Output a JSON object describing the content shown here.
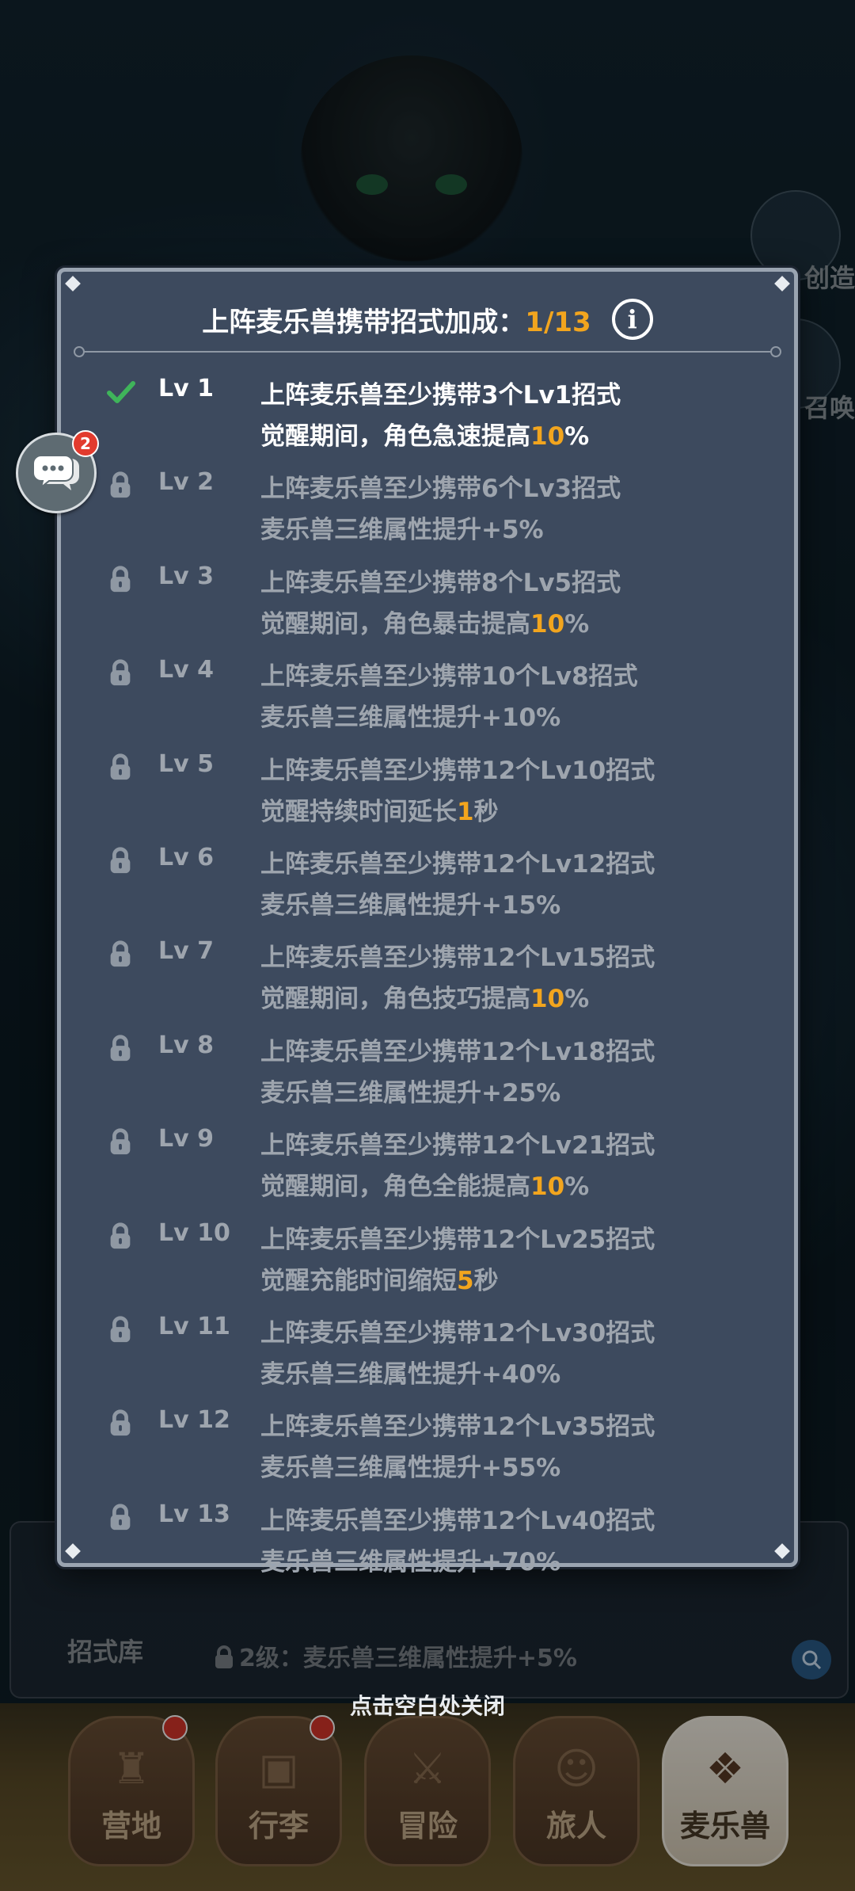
{
  "modal": {
    "title": "上阵麦乐兽携带招式加成：",
    "progress": "1/13",
    "info_symbol": "i",
    "levels": [
      {
        "lv": "Lv 1",
        "unlocked": true,
        "requirement": "上阵麦乐兽至少携带3个Lv1招式",
        "effect_prefix": "觉醒期间，角色急速提高",
        "effect_highlight": "10",
        "effect_suffix": "%"
      },
      {
        "lv": "Lv 2",
        "unlocked": false,
        "requirement": "上阵麦乐兽至少携带6个Lv3招式",
        "effect_prefix": "麦乐兽三维属性提升+5%",
        "effect_highlight": "",
        "effect_suffix": ""
      },
      {
        "lv": "Lv 3",
        "unlocked": false,
        "requirement": "上阵麦乐兽至少携带8个Lv5招式",
        "effect_prefix": "觉醒期间，角色暴击提高",
        "effect_highlight": "10",
        "effect_suffix": "%"
      },
      {
        "lv": "Lv 4",
        "unlocked": false,
        "requirement": "上阵麦乐兽至少携带10个Lv8招式",
        "effect_prefix": "麦乐兽三维属性提升+10%",
        "effect_highlight": "",
        "effect_suffix": ""
      },
      {
        "lv": "Lv 5",
        "unlocked": false,
        "requirement": "上阵麦乐兽至少携带12个Lv10招式",
        "effect_prefix": "觉醒持续时间延长",
        "effect_highlight": "1",
        "effect_suffix": "秒"
      },
      {
        "lv": "Lv 6",
        "unlocked": false,
        "requirement": "上阵麦乐兽至少携带12个Lv12招式",
        "effect_prefix": "麦乐兽三维属性提升+15%",
        "effect_highlight": "",
        "effect_suffix": ""
      },
      {
        "lv": "Lv 7",
        "unlocked": false,
        "requirement": "上阵麦乐兽至少携带12个Lv15招式",
        "effect_prefix": "觉醒期间，角色技巧提高",
        "effect_highlight": "10",
        "effect_suffix": "%"
      },
      {
        "lv": "Lv 8",
        "unlocked": false,
        "requirement": "上阵麦乐兽至少携带12个Lv18招式",
        "effect_prefix": "麦乐兽三维属性提升+25%",
        "effect_highlight": "",
        "effect_suffix": ""
      },
      {
        "lv": "Lv 9",
        "unlocked": false,
        "requirement": "上阵麦乐兽至少携带12个Lv21招式",
        "effect_prefix": "觉醒期间，角色全能提高",
        "effect_highlight": "10",
        "effect_suffix": "%"
      },
      {
        "lv": "Lv 10",
        "unlocked": false,
        "requirement": "上阵麦乐兽至少携带12个Lv25招式",
        "effect_prefix": "觉醒充能时间缩短",
        "effect_highlight": "5",
        "effect_suffix": "秒"
      },
      {
        "lv": "Lv 11",
        "unlocked": false,
        "requirement": "上阵麦乐兽至少携带12个Lv30招式",
        "effect_prefix": "麦乐兽三维属性提升+40%",
        "effect_highlight": "",
        "effect_suffix": ""
      },
      {
        "lv": "Lv 12",
        "unlocked": false,
        "requirement": "上阵麦乐兽至少携带12个Lv35招式",
        "effect_prefix": "麦乐兽三维属性提升+55%",
        "effect_highlight": "",
        "effect_suffix": ""
      },
      {
        "lv": "Lv 13",
        "unlocked": false,
        "requirement": "上阵麦乐兽至少携带12个Lv40招式",
        "effect_prefix": "麦乐兽三维属性提升+70%",
        "effect_highlight": "",
        "effect_suffix": ""
      }
    ]
  },
  "background": {
    "side_create_label": "创造",
    "side_summon_label": "召唤",
    "chat_badge": "2",
    "skill_library_label": "招式库",
    "level2_hint": "2级：麦乐兽三维属性提升+5%"
  },
  "close_hint": "点击空白处关闭",
  "nav": {
    "items": [
      {
        "label": "营地",
        "icon": "castle-icon",
        "badge": true
      },
      {
        "label": "行李",
        "icon": "chest-icon",
        "badge": true
      },
      {
        "label": "冒险",
        "icon": "crossed-swords-icon",
        "badge": false
      },
      {
        "label": "旅人",
        "icon": "traveler-icon",
        "badge": false
      },
      {
        "label": "麦乐兽",
        "icon": "pet-icon",
        "badge": false,
        "active": true
      }
    ]
  },
  "colors": {
    "highlight": "#f2a51e",
    "unlocked_text": "#ffffff",
    "locked_text": "#9ea5ae",
    "check": "#3fb45a",
    "modal_bg": "#3d4a5e"
  }
}
